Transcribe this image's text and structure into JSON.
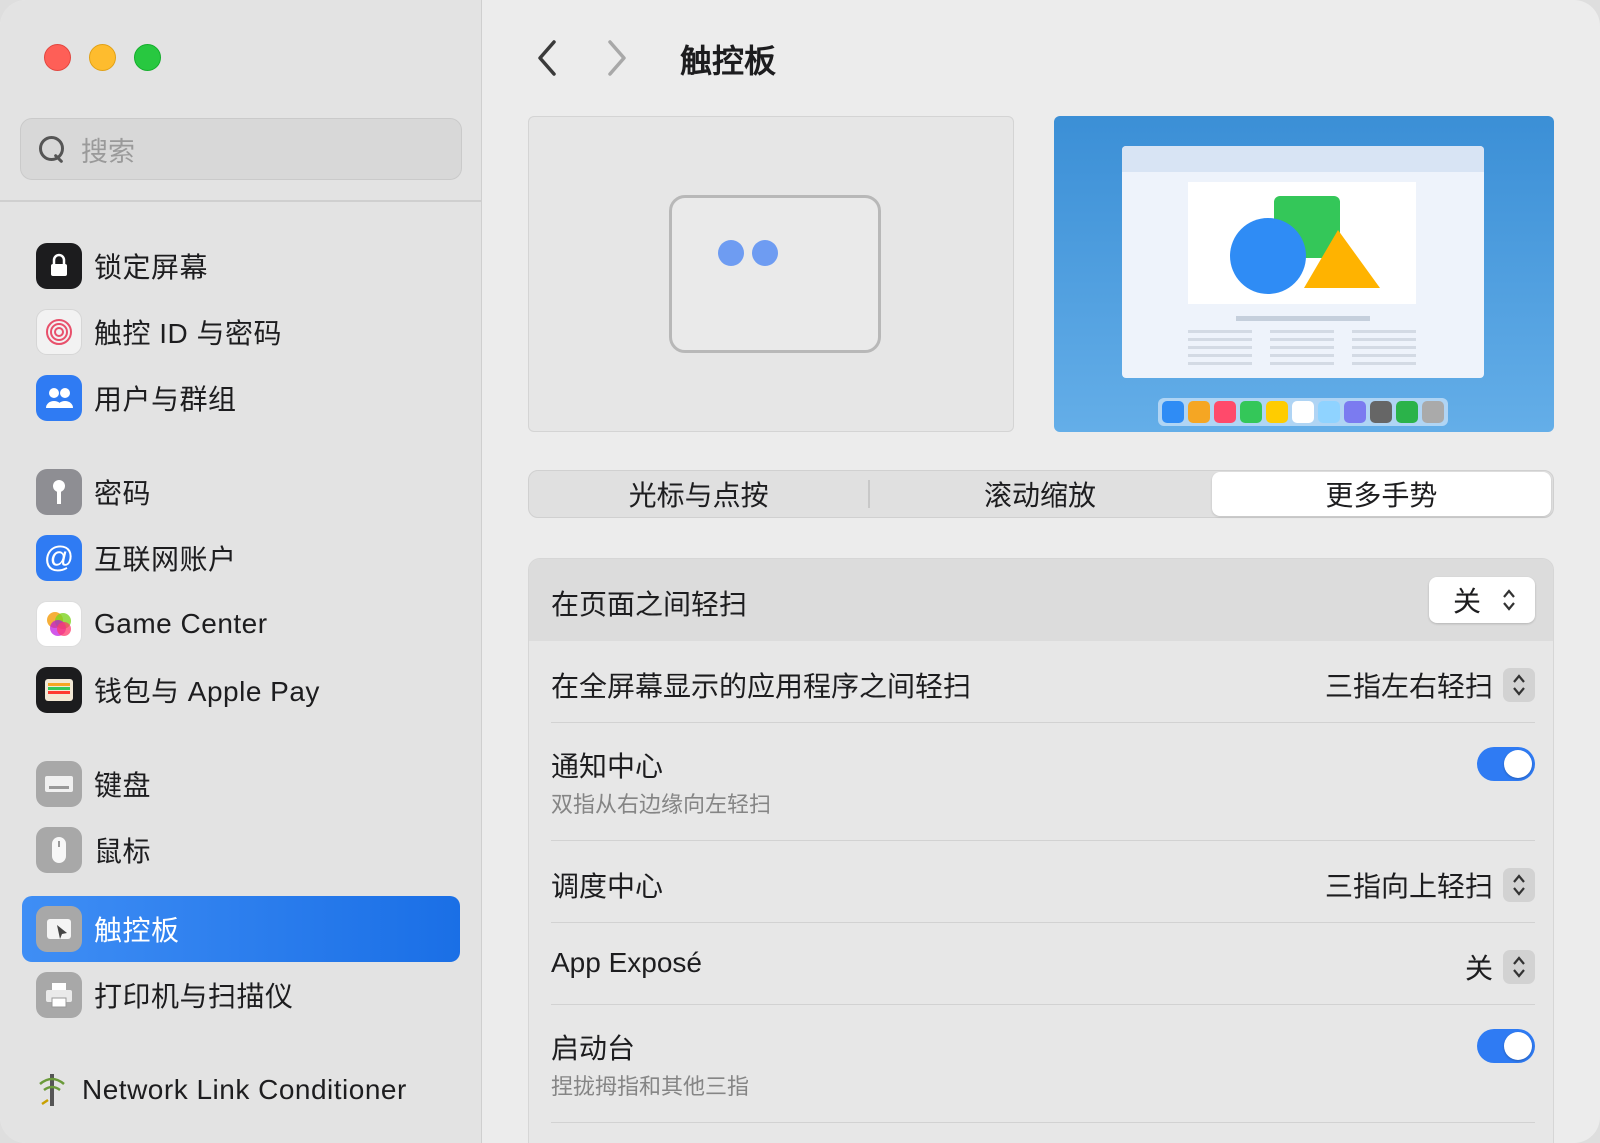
{
  "sidebar": {
    "search_placeholder": "搜索",
    "items": [
      {
        "label": "锁定屏幕",
        "icon": "lock-screen-icon",
        "color": "#1c1c1e"
      },
      {
        "label": "触控 ID 与密码",
        "icon": "fingerprint-icon",
        "color": "#f2f2f2"
      },
      {
        "label": "用户与群组",
        "icon": "users-icon",
        "color": "#2f7bf3"
      },
      {
        "label": "密码",
        "icon": "key-icon",
        "color": "#8e8e93"
      },
      {
        "label": "互联网账户",
        "icon": "at-icon",
        "color": "#2f7bf3"
      },
      {
        "label": "Game Center",
        "icon": "game-center-icon",
        "color": "#ffffff"
      },
      {
        "label": "钱包与 Apple Pay",
        "icon": "wallet-icon",
        "color": "#1c1c1e"
      },
      {
        "label": "键盘",
        "icon": "keyboard-icon",
        "color": "#9a9a9a"
      },
      {
        "label": "鼠标",
        "icon": "mouse-icon",
        "color": "#9a9a9a"
      },
      {
        "label": "触控板",
        "icon": "trackpad-icon",
        "color": "#9a9a9a"
      },
      {
        "label": "打印机与扫描仪",
        "icon": "printer-icon",
        "color": "#9a9a9a"
      },
      {
        "label": "Network Link Conditioner",
        "icon": "network-link-conditioner-icon",
        "color": "#e3e3e3"
      }
    ],
    "active_index": 9
  },
  "header": {
    "title": "触控板"
  },
  "tabs": [
    {
      "label": "光标与点按",
      "selected": false
    },
    {
      "label": "滚动缩放",
      "selected": false
    },
    {
      "label": "更多手势",
      "selected": true
    }
  ],
  "settings": {
    "rows": [
      {
        "title": "在页面之间轻扫",
        "control": "popup",
        "value": "关"
      },
      {
        "title": "在全屏幕显示的应用程序之间轻扫",
        "control": "popup",
        "value": "三指左右轻扫"
      },
      {
        "title": "通知中心",
        "subtitle": "双指从右边缘向左轻扫",
        "control": "toggle",
        "on": true
      },
      {
        "title": "调度中心",
        "control": "popup",
        "value": "三指向上轻扫"
      },
      {
        "title": "App Exposé",
        "control": "popup",
        "value": "关"
      },
      {
        "title": "启动台",
        "subtitle": "捏拢拇指和其他三指",
        "control": "toggle",
        "on": true
      }
    ]
  },
  "colors": {
    "accent": "#2f7bf3",
    "sidebar_active": "#1a6fe6"
  }
}
